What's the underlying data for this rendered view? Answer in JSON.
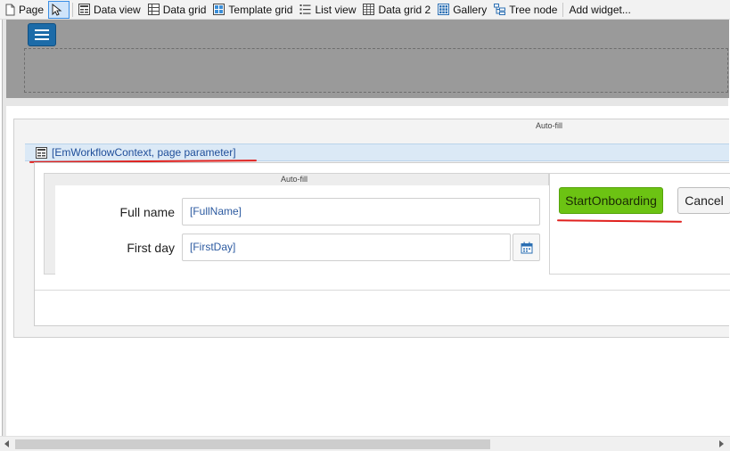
{
  "toolbar": {
    "items": [
      {
        "label": "Page",
        "icon": "page-icon"
      },
      {
        "label": "",
        "icon": "pointer-icon"
      },
      {
        "label": "Data view",
        "icon": "data-view-icon"
      },
      {
        "label": "Data grid",
        "icon": "data-grid-icon"
      },
      {
        "label": "Template grid",
        "icon": "template-grid-icon"
      },
      {
        "label": "List view",
        "icon": "list-view-icon"
      },
      {
        "label": "Data grid 2",
        "icon": "data-grid-2-icon"
      },
      {
        "label": "Gallery",
        "icon": "gallery-icon"
      },
      {
        "label": "Tree node",
        "icon": "tree-node-icon"
      },
      {
        "label": "Add widget...",
        "icon": ""
      }
    ]
  },
  "canvas": {
    "outer_autofill": "Auto-fill",
    "data_view_context": "[EmWorkflowContext, page parameter]",
    "inner_autofill": "Auto-fill",
    "form": {
      "full_name_label": "Full name",
      "full_name_value": "[FullName]",
      "first_day_label": "First day",
      "first_day_value": "[FirstDay]"
    },
    "buttons": {
      "start": "StartOnboarding",
      "cancel": "Cancel"
    }
  },
  "colors": {
    "accent_green": "#6cc313",
    "annotation_red": "#e0211e",
    "menu_blue": "#1c6ba8",
    "context_blue": "#1f4e9a"
  }
}
